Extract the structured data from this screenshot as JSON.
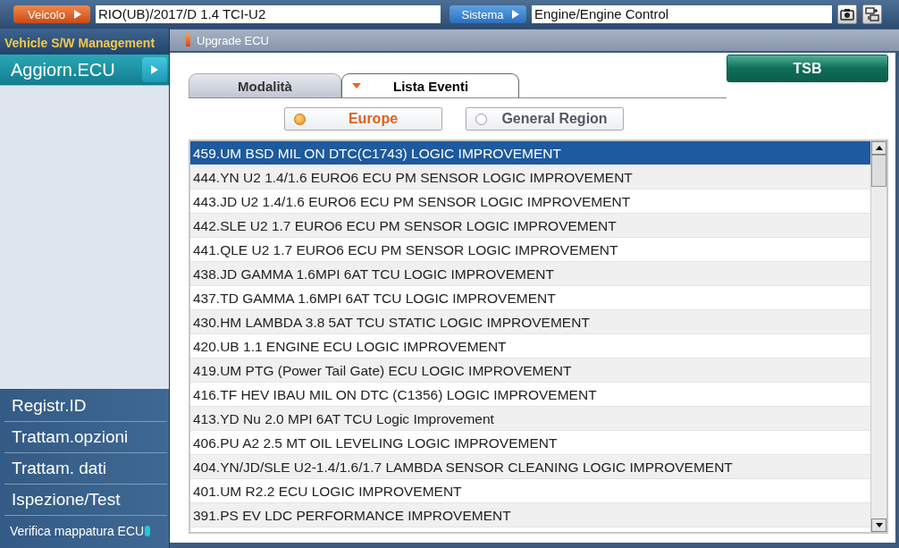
{
  "top_bar": {
    "vehicle_button": "Veicolo",
    "vehicle_value": "RIO(UB)/2017/D 1.4 TCI-U2",
    "system_button": "Sistema",
    "system_value": "Engine/Engine Control"
  },
  "sidebar": {
    "title": "Vehicle S/W Management",
    "items": [
      {
        "label": "Aggiorn.ECU",
        "selected": true
      }
    ],
    "bottom_items": [
      {
        "label": "Registr.ID",
        "kind": "plain"
      },
      {
        "label": "Trattam.opzioni",
        "kind": "plain"
      },
      {
        "label": "Trattam. dati",
        "kind": "plain"
      },
      {
        "label": "Ispezione/Test",
        "kind": "plain"
      },
      {
        "label": "Verifica mappatura ECU",
        "kind": "info"
      }
    ]
  },
  "panel": {
    "title": "Upgrade ECU",
    "tabs": [
      {
        "label": "Modalità",
        "selected": false
      },
      {
        "label": "Lista Eventi",
        "selected": true
      }
    ],
    "tsb_button": "TSB",
    "regions": [
      {
        "label": "Europe",
        "selected": true
      },
      {
        "label": "General Region",
        "selected": false
      }
    ],
    "events": [
      {
        "label": "459.UM BSD MIL ON DTC(C1743) LOGIC IMPROVEMENT",
        "selected": true
      },
      {
        "label": "444.YN U2 1.4/1.6 EURO6 ECU PM SENSOR LOGIC IMPROVEMENT",
        "selected": false
      },
      {
        "label": "443.JD U2 1.4/1.6 EURO6 ECU PM SENSOR LOGIC IMPROVEMENT",
        "selected": false
      },
      {
        "label": "442.SLE U2 1.7 EURO6 ECU PM SENSOR LOGIC IMPROVEMENT",
        "selected": false
      },
      {
        "label": "441.QLE U2 1.7 EURO6 ECU PM SENSOR LOGIC IMPROVEMENT",
        "selected": false
      },
      {
        "label": "438.JD GAMMA 1.6MPI 6AT TCU LOGIC IMPROVEMENT",
        "selected": false
      },
      {
        "label": "437.TD GAMMA 1.6MPI 6AT TCU LOGIC IMPROVEMENT",
        "selected": false
      },
      {
        "label": "430.HM LAMBDA 3.8 5AT TCU STATIC LOGIC IMPROVEMENT",
        "selected": false
      },
      {
        "label": "420.UB 1.1 ENGINE ECU LOGIC IMPROVEMENT",
        "selected": false
      },
      {
        "label": "419.UM PTG (Power Tail Gate) ECU LOGIC IMPROVEMENT",
        "selected": false
      },
      {
        "label": "416.TF HEV IBAU MIL ON DTC (C1356) LOGIC IMPROVEMENT",
        "selected": false
      },
      {
        "label": "413.YD Nu 2.0 MPI 6AT TCU Logic Improvement",
        "selected": false
      },
      {
        "label": "406.PU A2 2.5 MT OIL LEVELING LOGIC IMPROVEMENT",
        "selected": false
      },
      {
        "label": "404.YN/JD/SLE  U2-1.4/1.6/1.7 LAMBDA  SENSOR  CLEANING LOGIC  IMPROVEMENT",
        "selected": false
      },
      {
        "label": "401.UM R2.2 ECU LOGIC IMPROVEMENT",
        "selected": false
      },
      {
        "label": "391.PS EV LDC PERFORMANCE IMPROVEMENT",
        "selected": false
      }
    ]
  }
}
